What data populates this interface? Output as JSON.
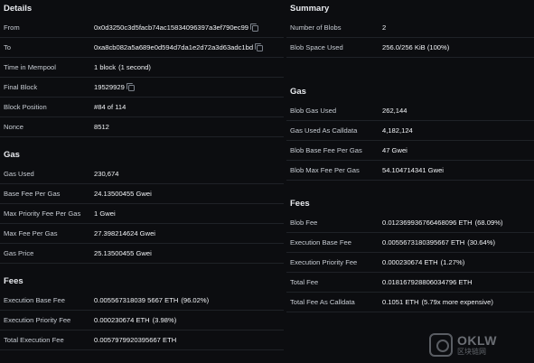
{
  "details": {
    "title": "Details",
    "rows": [
      {
        "label": "From",
        "value": "0x0d3250c3d5facb74ac15834096397a3ef790ec99",
        "copy": true
      },
      {
        "label": "To",
        "value": "0xa8cb082a5a689e0d594d7da1e2d72a3d63adc1bd",
        "copy": true
      },
      {
        "label": "Time in Mempool",
        "value": "1 block",
        "extra": "(1 second)"
      },
      {
        "label": "Final Block",
        "value": "19529929",
        "copy": true
      },
      {
        "label": "Block Position",
        "value": "#84 of 114"
      },
      {
        "label": "Nonce",
        "value": "8512"
      }
    ]
  },
  "gas_left": {
    "title": "Gas",
    "rows": [
      {
        "label": "Gas Used",
        "value": "230,674"
      },
      {
        "label": "Base Fee Per Gas",
        "value": "24.13500455 Gwei"
      },
      {
        "label": "Max Priority Fee Per Gas",
        "value": "1 Gwei"
      },
      {
        "label": "Max Fee Per Gas",
        "value": "27.398214624 Gwei"
      },
      {
        "label": "Gas Price",
        "value": "25.13500455 Gwei"
      }
    ]
  },
  "fees_left": {
    "title": "Fees",
    "rows": [
      {
        "label": "Execution Base Fee",
        "value": "0.005567318039 5667 ETH",
        "extra": "(96.02%)"
      },
      {
        "label": "Execution Priority Fee",
        "value": "0.000230674 ETH",
        "extra": "(3.98%)"
      },
      {
        "label": "Total Execution Fee",
        "value": "0.0057979920395667 ETH"
      }
    ]
  },
  "summary": {
    "title": "Summary",
    "rows": [
      {
        "label": "Number of Blobs",
        "value": "2"
      },
      {
        "label": "Blob Space Used",
        "value": "256.0/256 KiB (100%)"
      }
    ]
  },
  "gas_right": {
    "title": "Gas",
    "rows": [
      {
        "label": "Blob Gas Used",
        "value": "262,144"
      },
      {
        "label": "Gas Used As Calldata",
        "value": "4,182,124"
      },
      {
        "label": "Blob Base Fee Per Gas",
        "value": "47 Gwei"
      },
      {
        "label": "Blob Max Fee Per Gas",
        "value": "54.104714341 Gwei"
      }
    ]
  },
  "fees_right": {
    "title": "Fees",
    "rows": [
      {
        "label": "Blob Fee",
        "value": "0.012369936766468096 ETH",
        "extra": "(68.09%)"
      },
      {
        "label": "Execution Base Fee",
        "value": "0.0055673180395667 ETH",
        "extra": "(30.64%)"
      },
      {
        "label": "Execution Priority Fee",
        "value": "0.000230674 ETH",
        "extra": "(1.27%)"
      },
      {
        "label": "Total Fee",
        "value": "0.018167928806034796 ETH"
      },
      {
        "label": "Total Fee As Calldata",
        "value": "0.1051 ETH",
        "extra": "(5.79x more expensive)"
      }
    ]
  },
  "watermark": {
    "main": "OKLW",
    "sub": "区块链网"
  }
}
